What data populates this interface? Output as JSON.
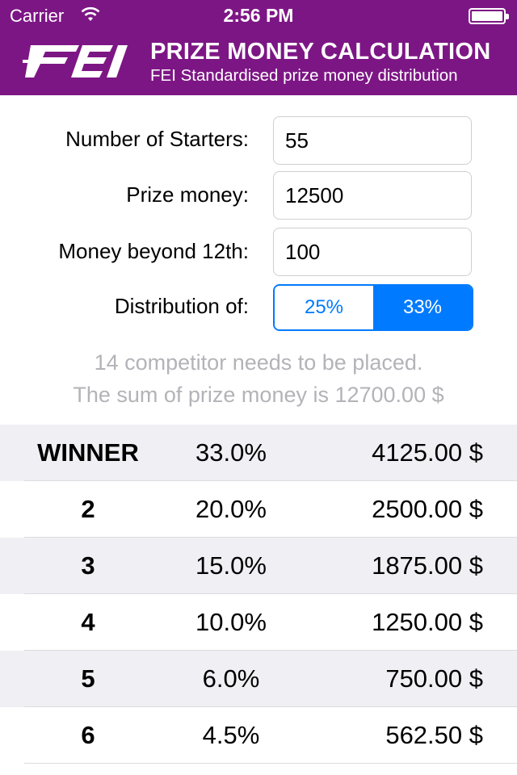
{
  "status_bar": {
    "carrier": "Carrier",
    "time": "2:56 PM"
  },
  "header": {
    "logo_text": "FEI",
    "title": "PRIZE MONEY CALCULATION",
    "subtitle": "FEI Standardised prize money distribution",
    "background_color": "#7d1685"
  },
  "form": {
    "starters_label": "Number of Starters:",
    "starters_value": "55",
    "prize_label": "Prize money:",
    "prize_value": "12500",
    "beyond_label": "Money beyond 12th:",
    "beyond_value": "100",
    "distribution_label": "Distribution of:",
    "distribution_options": [
      "25%",
      "33%"
    ],
    "distribution_selected": "33%",
    "accent_color": "#007aff"
  },
  "summary": {
    "placed_text": "14 competitor needs to be placed.",
    "sum_text": "The sum of prize money is 12700.00 $"
  },
  "table": {
    "rows": [
      {
        "place": "WINNER",
        "percent": "33.0%",
        "amount": "4125.00 $"
      },
      {
        "place": "2",
        "percent": "20.0%",
        "amount": "2500.00 $"
      },
      {
        "place": "3",
        "percent": "15.0%",
        "amount": "1875.00 $"
      },
      {
        "place": "4",
        "percent": "10.0%",
        "amount": "1250.00 $"
      },
      {
        "place": "5",
        "percent": "6.0%",
        "amount": "750.00 $"
      },
      {
        "place": "6",
        "percent": "4.5%",
        "amount": "562.50 $"
      }
    ]
  }
}
